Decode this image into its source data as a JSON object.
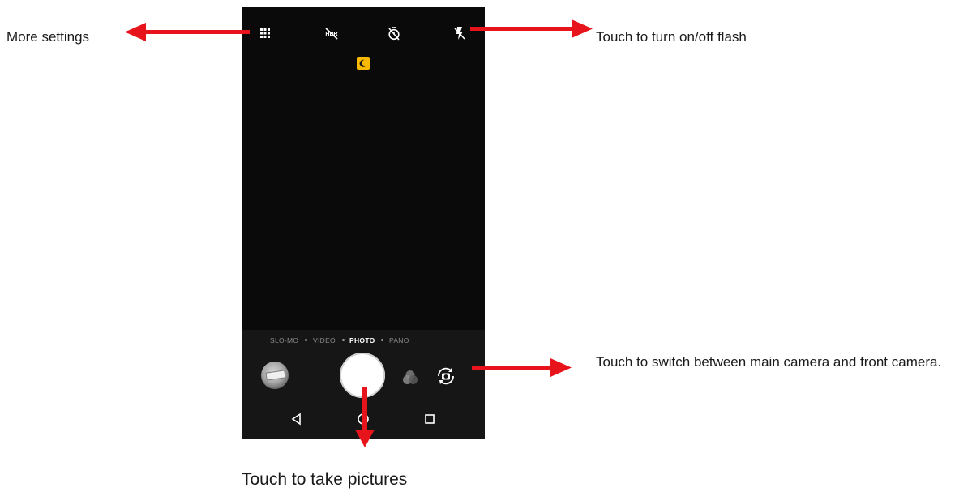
{
  "callouts": {
    "more_settings": "More settings",
    "flash": "Touch to turn on/off flash",
    "switch_camera": "Touch to switch between main camera and front camera.",
    "shutter": "Touch to take pictures"
  },
  "camera": {
    "modes": [
      {
        "label": "SLO-MO",
        "active": false
      },
      {
        "label": "VIDEO",
        "active": false
      },
      {
        "label": "PHOTO",
        "active": true
      },
      {
        "label": "PANO",
        "active": false
      }
    ],
    "top_icons": [
      "grid-icon",
      "hdr-off-icon",
      "timer-off-icon",
      "flash-off-icon"
    ],
    "night_mode_icon": "moon-icon",
    "bottom_icons": [
      "gallery-thumbnail",
      "shutter-button",
      "filter-icon",
      "switch-camera-icon"
    ],
    "nav_icons": [
      "back-icon",
      "home-icon",
      "recents-icon"
    ]
  },
  "colors": {
    "arrow": "#e8141c",
    "night_badge": "#f9b900",
    "viewfinder": "#0a0a0a"
  }
}
